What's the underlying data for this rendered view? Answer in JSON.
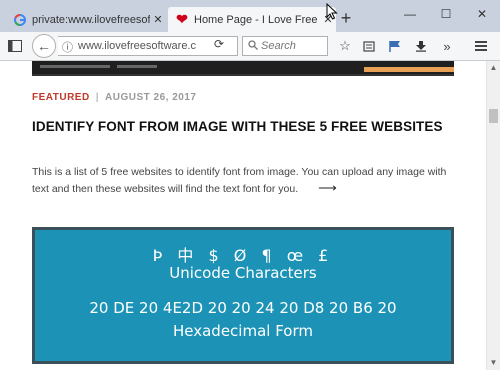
{
  "tabs": [
    {
      "title": "private:www.ilovefreesoftware.",
      "favicon": "google-g",
      "active": false
    },
    {
      "title": "Home Page - I Love Free Sof",
      "favicon": "heart",
      "active": true
    }
  ],
  "toolbar": {
    "url": "www.ilovefreesoftware.c",
    "search_placeholder": "Search"
  },
  "article": {
    "category": "FEATURED",
    "date": "AUGUST 26, 2017",
    "title": "IDENTIFY FONT FROM IMAGE WITH THESE 5 FREE WEBSITES",
    "excerpt": "This is a list of 5 free websites to identify font from image. You can upload any image with text and then these websites will find the text font for you.",
    "read_more_arrow": "⟶"
  },
  "feature_image": {
    "symbols": "Þ 中 $ Ø ¶ œ £",
    "line2": "Unicode Characters",
    "hex": "20 DE 20 4E2D 20 20 24 20 D8 20 B6 20",
    "line4": "Hexadecimal Form"
  },
  "colors": {
    "accent_red": "#c0392b",
    "feature_bg": "#1c93b6",
    "tabbar_bg": "#c9d1df"
  }
}
